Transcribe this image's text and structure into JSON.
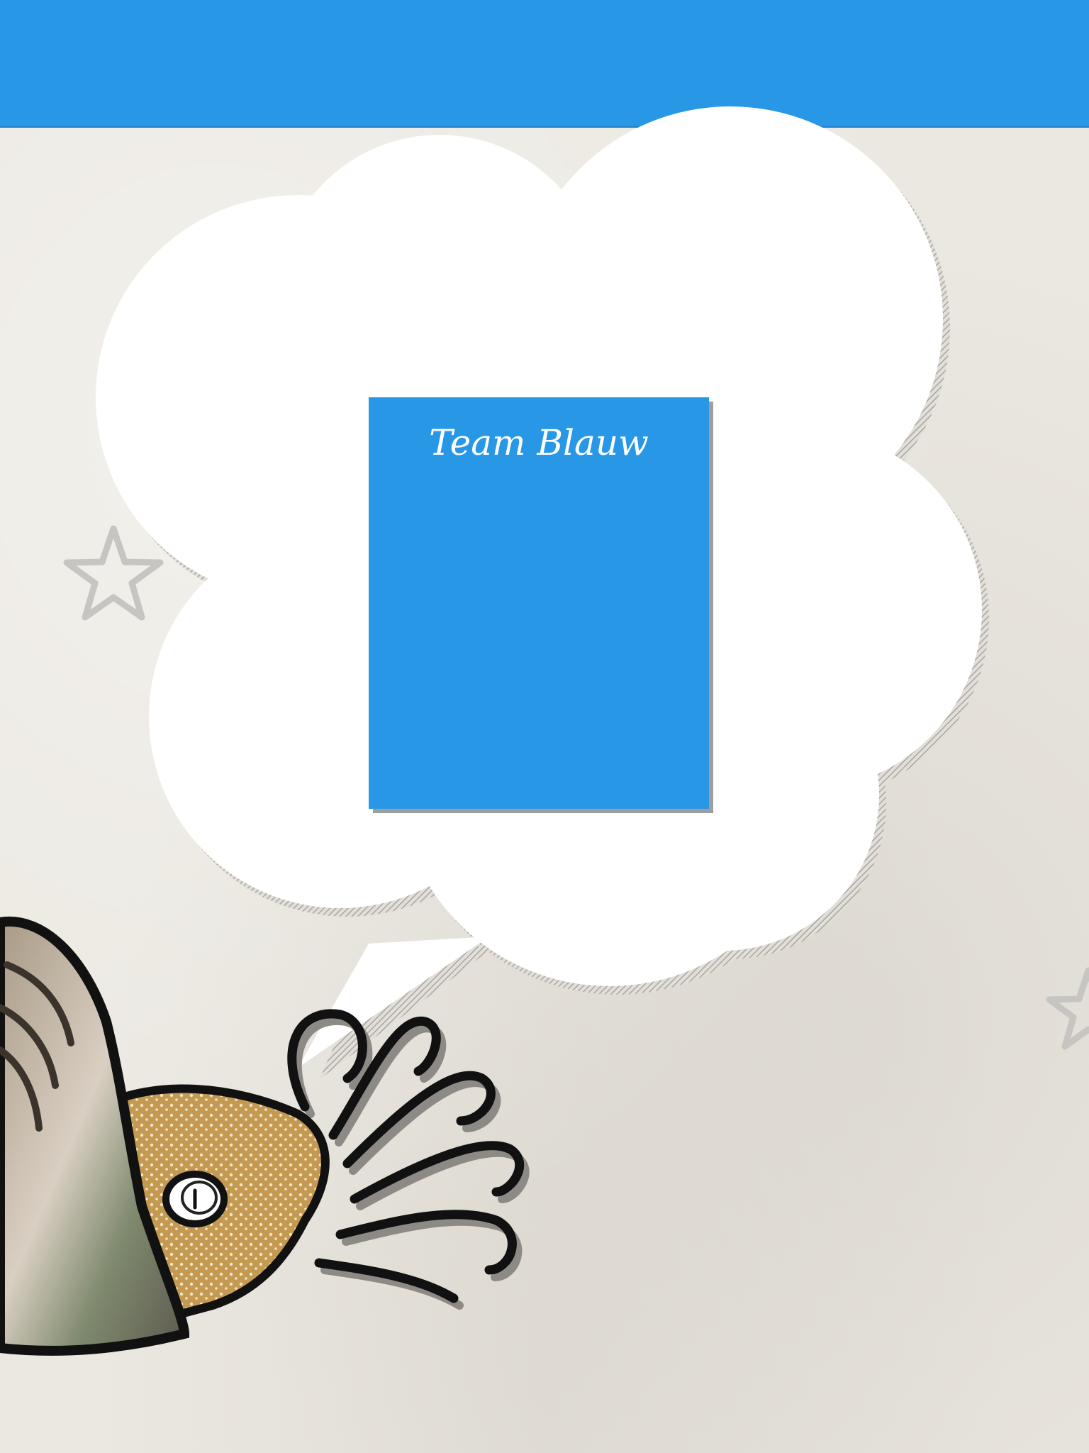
{
  "colors": {
    "header": "#2797e6",
    "card": "#2797e6",
    "bubble": "#ffffff",
    "background": "#ebe8e1"
  },
  "team_card": {
    "title": "Team Blauw"
  },
  "mascot": {
    "icon": "nautilus-icon"
  },
  "decorations": [
    "star-icon",
    "star-icon"
  ]
}
